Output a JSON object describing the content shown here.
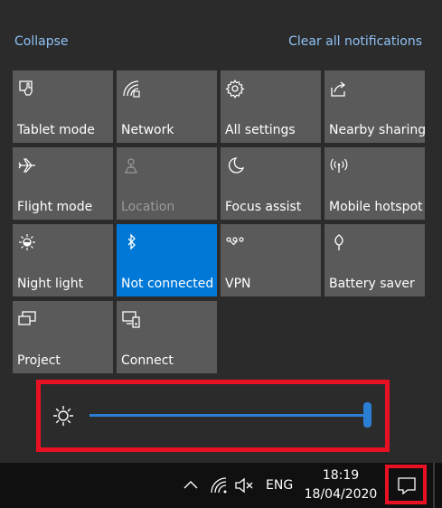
{
  "header": {
    "collapse": "Collapse",
    "clear_all": "Clear all notifications"
  },
  "quick_actions": [
    {
      "label": "Tablet mode",
      "icon": "tablet-mode-icon",
      "state": "off"
    },
    {
      "label": "Network",
      "icon": "network-icon",
      "state": "off"
    },
    {
      "label": "All settings",
      "icon": "gear-icon",
      "state": "off"
    },
    {
      "label": "Nearby sharing",
      "icon": "nearby-sharing-icon",
      "state": "off"
    },
    {
      "label": "Flight mode",
      "icon": "airplane-icon",
      "state": "off"
    },
    {
      "label": "Location",
      "icon": "location-icon",
      "state": "disabled"
    },
    {
      "label": "Focus assist",
      "icon": "moon-icon",
      "state": "off"
    },
    {
      "label": "Mobile hotspot",
      "icon": "hotspot-icon",
      "state": "off"
    },
    {
      "label": "Night light",
      "icon": "night-light-icon",
      "state": "off"
    },
    {
      "label": "Not connected",
      "icon": "bluetooth-icon",
      "state": "on"
    },
    {
      "label": "VPN",
      "icon": "vpn-icon",
      "state": "off"
    },
    {
      "label": "Battery saver",
      "icon": "battery-saver-icon",
      "state": "off"
    },
    {
      "label": "Project",
      "icon": "project-icon",
      "state": "off"
    },
    {
      "label": "Connect",
      "icon": "connect-icon",
      "state": "off"
    }
  ],
  "brightness": {
    "icon": "sun-icon",
    "level_percent": 100
  },
  "taskbar": {
    "language": "ENG",
    "time": "18:19",
    "date": "18/04/2020",
    "tray_icons": [
      "chevron-up-icon",
      "wifi-icon",
      "volume-muted-icon"
    ],
    "notification_icon": "notification-icon"
  },
  "colors": {
    "accent": "#0078d7",
    "tile": "#5a5a5a",
    "link": "#8fc2f5",
    "highlight": "#e81123"
  }
}
